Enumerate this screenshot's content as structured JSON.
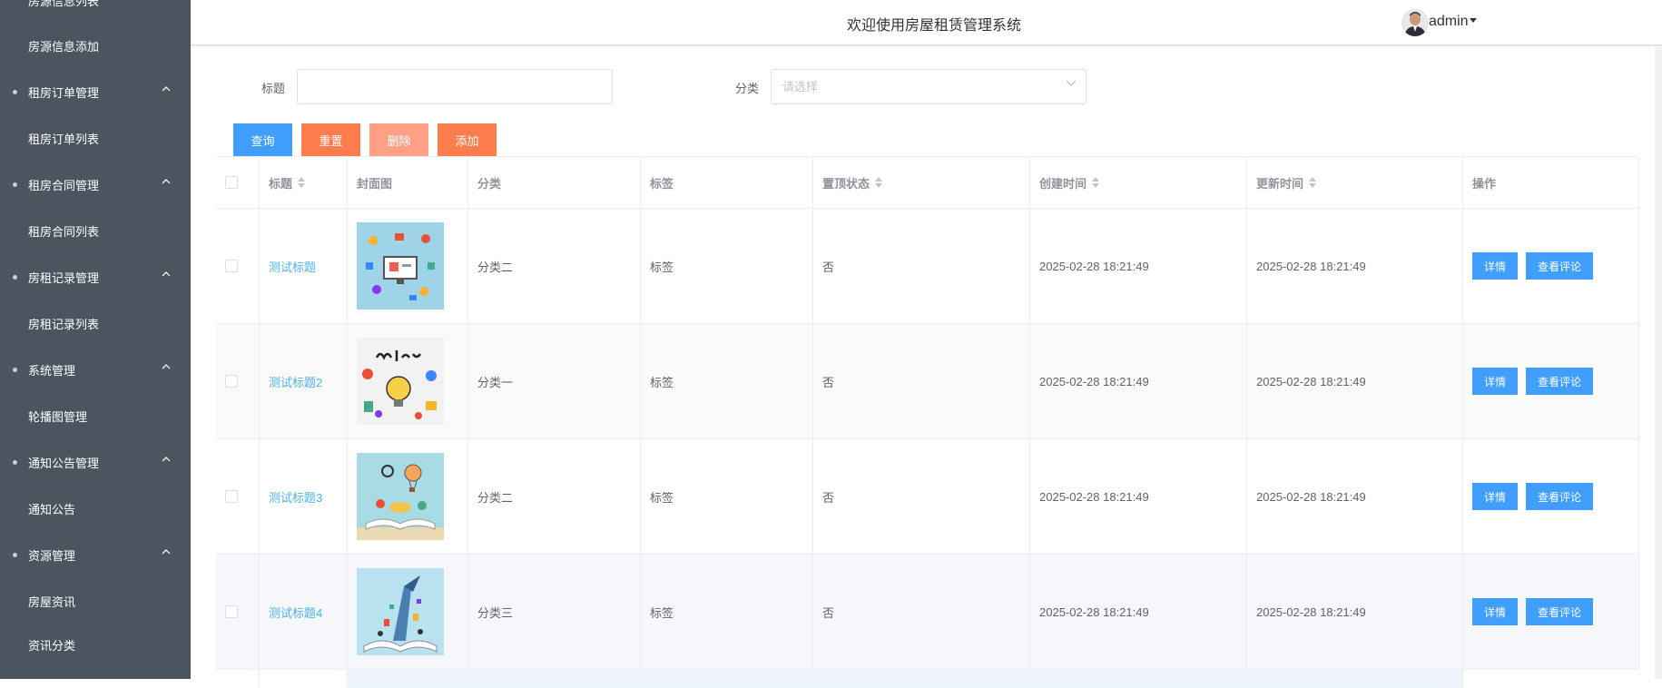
{
  "sidebar": {
    "items": [
      {
        "label": "房源信息列表",
        "type": "item"
      },
      {
        "label": "房源信息添加",
        "type": "item"
      },
      {
        "label": "租房订单管理",
        "type": "group"
      },
      {
        "label": "租房订单列表",
        "type": "item"
      },
      {
        "label": "租房合同管理",
        "type": "group"
      },
      {
        "label": "租房合同列表",
        "type": "item"
      },
      {
        "label": "房租记录管理",
        "type": "group"
      },
      {
        "label": "房租记录列表",
        "type": "item"
      },
      {
        "label": "系统管理",
        "type": "group"
      },
      {
        "label": "轮播图管理",
        "type": "item"
      },
      {
        "label": "通知公告管理",
        "type": "group"
      },
      {
        "label": "通知公告",
        "type": "item"
      },
      {
        "label": "资源管理",
        "type": "group"
      },
      {
        "label": "房屋资讯",
        "type": "item"
      },
      {
        "label": "资讯分类",
        "type": "item"
      }
    ]
  },
  "header": {
    "title": "欢迎使用房屋租赁管理系统",
    "username": "admin"
  },
  "search": {
    "title_label": "标题",
    "title_value": "",
    "category_label": "分类",
    "category_placeholder": "请选择"
  },
  "toolbar": {
    "query": "查询",
    "reset": "重置",
    "delete": "删除",
    "add": "添加"
  },
  "table": {
    "columns": [
      "标题",
      "封面图",
      "分类",
      "标签",
      "置顶状态",
      "创建时间",
      "更新时间",
      "操作"
    ],
    "rows": [
      {
        "title": "测试标题",
        "cover": "digital-icons-illustration",
        "category": "分类二",
        "tag": "标签",
        "pinned": "否",
        "created": "2025-02-28 18:21:49",
        "updated": "2025-02-28 18:21:49"
      },
      {
        "title": "测试标题2",
        "cover": "learn-lightbulb-illustration",
        "category": "分类一",
        "tag": "标签",
        "pinned": "否",
        "created": "2025-02-28 18:21:49",
        "updated": "2025-02-28 18:21:49"
      },
      {
        "title": "测试标题3",
        "cover": "open-book-balloon-illustration",
        "category": "分类二",
        "tag": "标签",
        "pinned": "否",
        "created": "2025-02-28 18:21:49",
        "updated": "2025-02-28 18:21:49"
      },
      {
        "title": "测试标题4",
        "cover": "open-book-growth-illustration",
        "category": "分类三",
        "tag": "标签",
        "pinned": "否",
        "created": "2025-02-28 18:21:49",
        "updated": "2025-02-28 18:21:49"
      }
    ],
    "action_detail": "详情",
    "action_comments": "查看评论"
  },
  "colors": {
    "sidebar_bg": "#4a5560",
    "primary": "#409eff",
    "warning": "#ff7c4d",
    "danger_disabled": "#ff9f85",
    "link": "#4fb3e8"
  }
}
